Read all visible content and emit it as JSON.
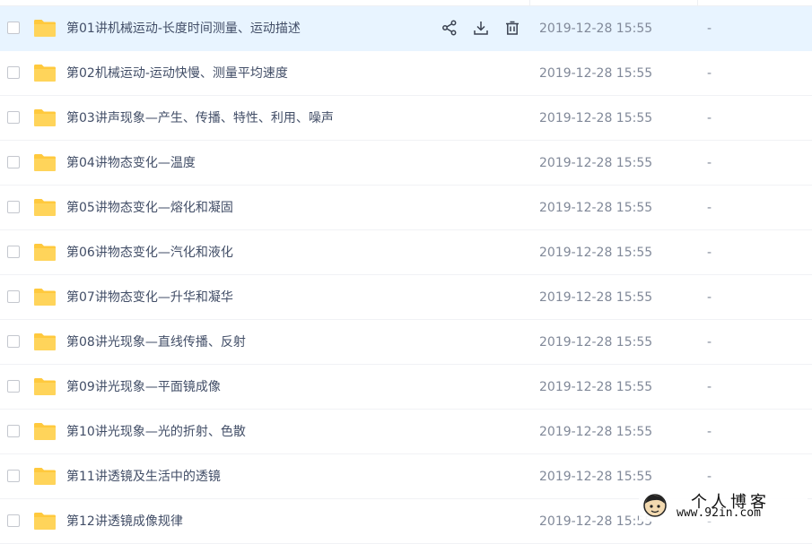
{
  "rows": [
    {
      "name": "第01讲机械运动-长度时间测量、运动描述",
      "date": "2019-12-28 15:55",
      "size": "-"
    },
    {
      "name": "第02机械运动-运动快慢、测量平均速度",
      "date": "2019-12-28 15:55",
      "size": "-"
    },
    {
      "name": "第03讲声现象—产生、传播、特性、利用、噪声",
      "date": "2019-12-28 15:55",
      "size": "-"
    },
    {
      "name": "第04讲物态变化—温度",
      "date": "2019-12-28 15:55",
      "size": "-"
    },
    {
      "name": "第05讲物态变化—熔化和凝固",
      "date": "2019-12-28 15:55",
      "size": "-"
    },
    {
      "name": "第06讲物态变化—汽化和液化",
      "date": "2019-12-28 15:55",
      "size": "-"
    },
    {
      "name": "第07讲物态变化—升华和凝华",
      "date": "2019-12-28 15:55",
      "size": "-"
    },
    {
      "name": "第08讲光现象—直线传播、反射",
      "date": "2019-12-28 15:55",
      "size": "-"
    },
    {
      "name": "第09讲光现象—平面镜成像",
      "date": "2019-12-28 15:55",
      "size": "-"
    },
    {
      "name": "第10讲光现象—光的折射、色散",
      "date": "2019-12-28 15:55",
      "size": "-"
    },
    {
      "name": "第11讲透镜及生活中的透镜",
      "date": "2019-12-28 15:55",
      "size": "-"
    },
    {
      "name": "第12讲透镜成像规律",
      "date": "2019-12-28 15:55",
      "size": "-"
    }
  ],
  "row_actions": {
    "share_icon": "share-icon",
    "download_icon": "download-icon",
    "delete_icon": "trash-icon"
  },
  "watermark": {
    "title": "个人博客",
    "url": "www.92in.com"
  },
  "colors": {
    "folder": "#ffc93d",
    "hover_row": "#e8f4ff",
    "name_text": "#424e67",
    "meta_text": "#818999"
  }
}
